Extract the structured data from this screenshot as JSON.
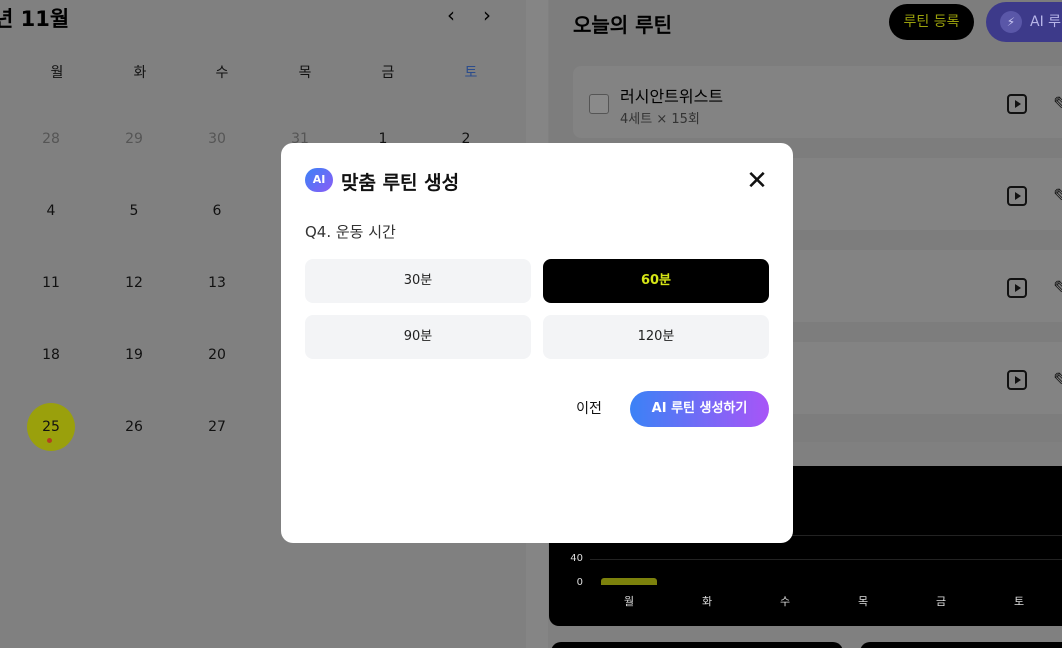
{
  "calendar": {
    "month_title": "년 11월",
    "prev_icon": "chevron-left-icon",
    "next_icon": "chevron-right-icon",
    "weekdays": [
      "월",
      "화",
      "수",
      "목",
      "금",
      "토"
    ],
    "rows": [
      [
        "28",
        "29",
        "30",
        "31",
        "1",
        "2"
      ],
      [
        "4",
        "5",
        "6"
      ],
      [
        "11",
        "12",
        "13"
      ],
      [
        "18",
        "19",
        "20"
      ],
      [
        "25",
        "26",
        "27"
      ]
    ],
    "today": "25"
  },
  "routine": {
    "title": "오늘의 루틴",
    "register_label": "루틴 등록",
    "ai_label": "AI 루",
    "ai_icon": "bolt-icon",
    "items": [
      {
        "name": "러시안트위스트",
        "meta": "4세트 × 15회"
      }
    ],
    "play_icon": "play-box-icon",
    "edit_icon": "pencil-icon"
  },
  "chart_data": {
    "type": "bar",
    "categories": [
      "월",
      "화",
      "수",
      "목",
      "금",
      "토"
    ],
    "values": [
      5,
      0,
      0,
      0,
      0,
      0
    ],
    "yticks": [
      "40",
      "0"
    ],
    "ylim": [
      0,
      40
    ]
  },
  "modal": {
    "badge": "AI",
    "title": "맞춤 루틴 생성",
    "close_icon": "close-icon",
    "question": "Q4. 운동 시간",
    "options": [
      {
        "label": "30분",
        "selected": false
      },
      {
        "label": "60분",
        "selected": true
      },
      {
        "label": "90분",
        "selected": false
      },
      {
        "label": "120분",
        "selected": false
      }
    ],
    "prev_label": "이전",
    "generate_label": "AI 루틴 생성하기"
  },
  "colors": {
    "accent_lime": "#d6e616",
    "gradient_start": "#3b82f6",
    "gradient_end": "#a855f7"
  }
}
